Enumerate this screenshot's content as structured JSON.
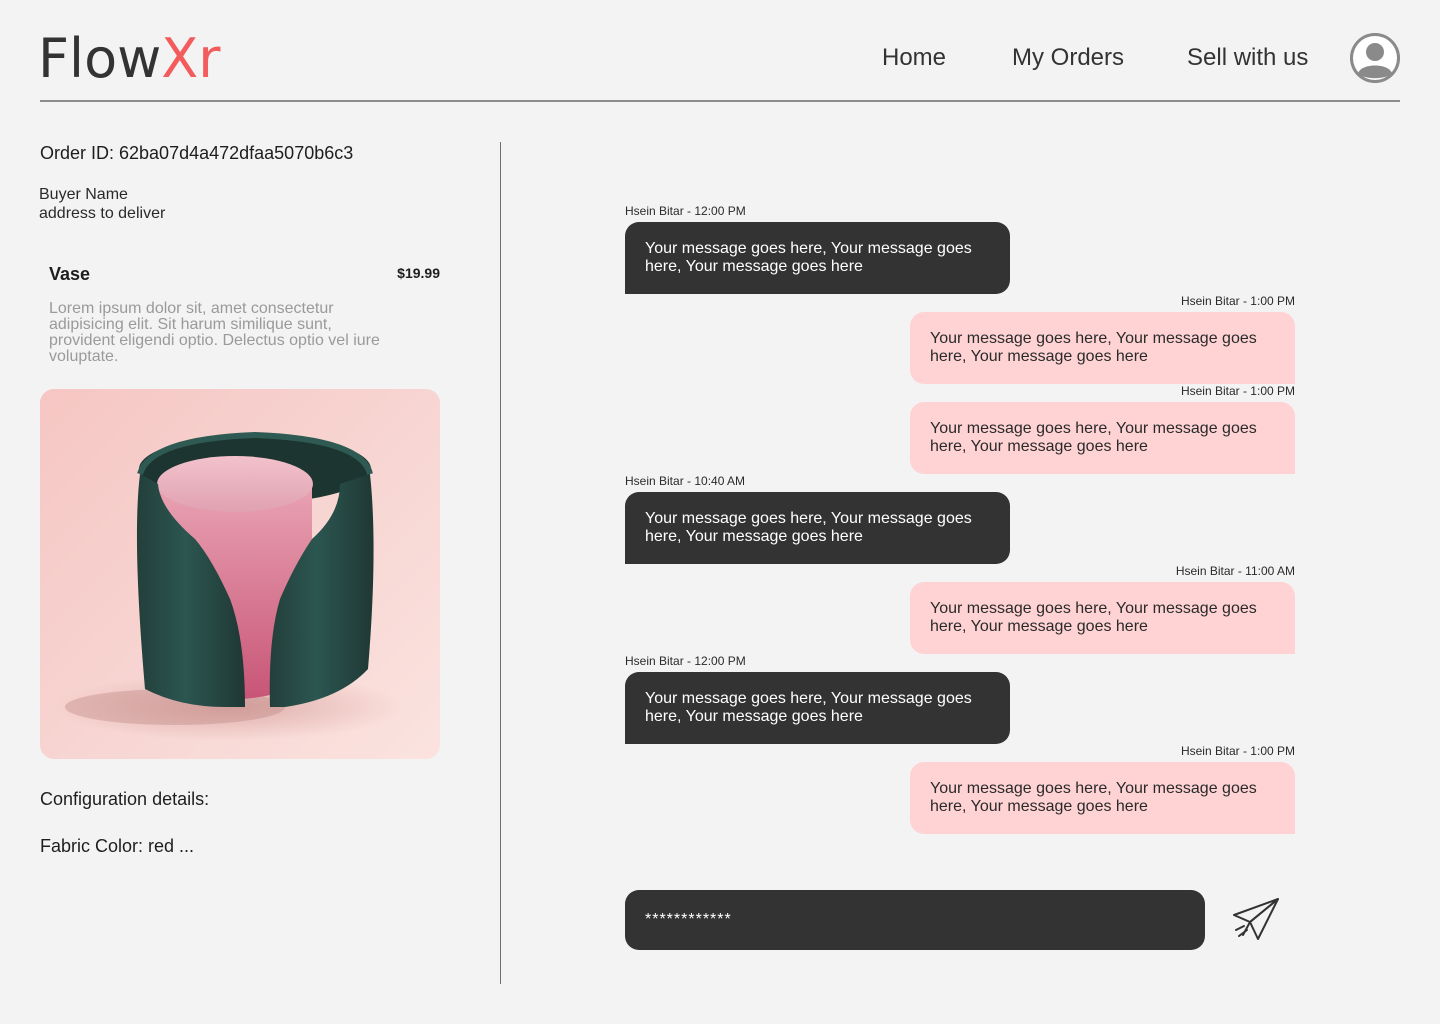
{
  "header": {
    "logo_part1": "Flow",
    "logo_part2": "Xr",
    "nav": {
      "home": "Home",
      "orders": "My Orders",
      "sell": "Sell with us"
    },
    "avatar_icon": "user-icon"
  },
  "order": {
    "id_label": "Order ID: 62ba07d4a472dfaa5070b6c3",
    "buyer_name": "Buyer Name",
    "buyer_address": "address to deliver",
    "product": {
      "name": "Vase",
      "price": "$19.99",
      "description": "Lorem ipsum dolor sit, amet consectetur adipisicing elit. Sit harum similique sunt, provident eligendi optio. Delectus optio vel iure voluptate."
    },
    "config_title": "Configuration details:",
    "config_fabric": "Fabric Color: red ..."
  },
  "chat": {
    "messages": [
      {
        "direction": "incoming",
        "meta": "Hsein Bitar - 12:00 PM",
        "text": "Your message goes here, Your message goes here, Your message goes here"
      },
      {
        "direction": "outgoing",
        "meta": "Hsein Bitar - 1:00 PM",
        "text": "Your message goes here, Your message goes here, Your message goes here"
      },
      {
        "direction": "outgoing",
        "meta": "Hsein Bitar - 1:00 PM",
        "text": "Your message goes here, Your message goes here, Your message goes here"
      },
      {
        "direction": "incoming",
        "meta": "Hsein Bitar - 10:40 AM",
        "text": "Your message goes here, Your message goes here, Your message goes here"
      },
      {
        "direction": "outgoing",
        "meta": "Hsein Bitar - 11:00 AM",
        "text": "Your message goes here, Your message goes here, Your message goes here"
      },
      {
        "direction": "incoming",
        "meta": "Hsein Bitar - 12:00 PM",
        "text": "Your message goes here, Your message goes here, Your message goes here"
      },
      {
        "direction": "outgoing",
        "meta": "Hsein Bitar - 1:00 PM",
        "text": "Your message goes here, Your message goes here, Your message goes here"
      }
    ],
    "composer_value": "************",
    "send_icon": "send-icon"
  },
  "colors": {
    "background": "#f3f3f3",
    "logo_accent": "#f25c5c",
    "incoming_bubble": "#333333",
    "outgoing_bubble": "#ffd3d3"
  }
}
